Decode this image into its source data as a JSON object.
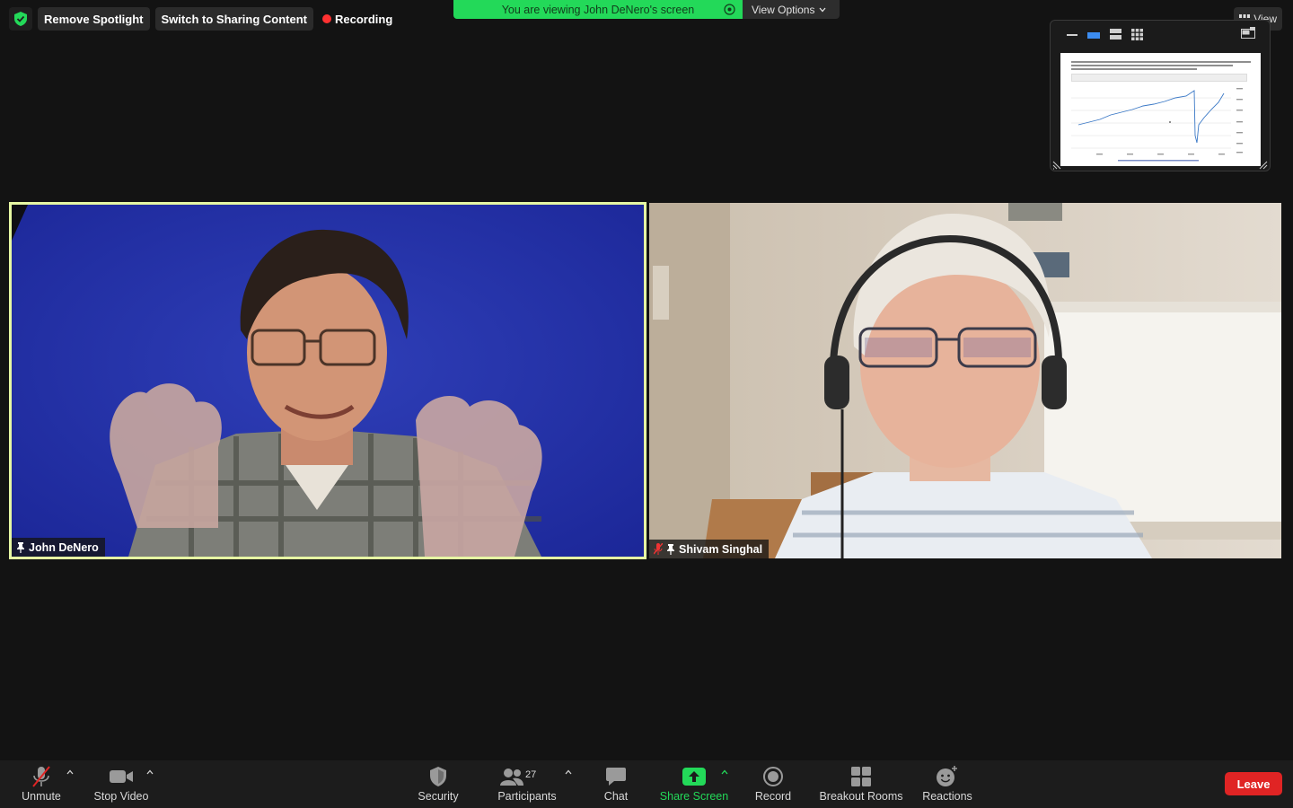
{
  "top_bar": {
    "remove_spotlight": "Remove Spotlight",
    "switch_sharing": "Switch to Sharing Content",
    "recording": "Recording",
    "view_label": "View"
  },
  "share_banner": {
    "message": "You are viewing John DeNero's screen",
    "view_options": "View Options"
  },
  "participants": [
    {
      "name": "John DeNero",
      "pinned": true,
      "muted": false,
      "speaking": true
    },
    {
      "name": "Shivam Singhal",
      "pinned": true,
      "muted": true,
      "speaking": false
    }
  ],
  "toolbar": {
    "unmute": "Unmute",
    "stop_video": "Stop Video",
    "security": "Security",
    "participants": "Participants",
    "participant_count": "27",
    "chat": "Chat",
    "share_screen": "Share Screen",
    "record": "Record",
    "breakout_rooms": "Breakout Rooms",
    "reactions": "Reactions",
    "leave": "Leave"
  },
  "colors": {
    "share_green": "#23d959",
    "active_speaker_border": "#e6f7a3",
    "leave_red": "#e02424",
    "recording_red": "#ff3131"
  },
  "icons": [
    "shield-check-icon",
    "record-dot-icon",
    "target-icon",
    "chevron-down-icon",
    "grid-icon",
    "pin-icon",
    "mic-muted-icon",
    "video-camera-icon",
    "security-shield-icon",
    "participants-icon",
    "chat-bubble-icon",
    "share-up-arrow-icon",
    "record-icon",
    "breakout-rooms-icon",
    "reactions-icon"
  ]
}
